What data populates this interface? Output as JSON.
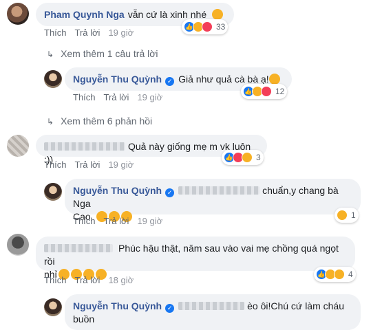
{
  "comments": [
    {
      "name": "Pham Quynh Nga",
      "text": "vẫn cứ là xinh nhé",
      "react_count": "33"
    },
    {
      "name": "Nguyễn Thu Quỳnh",
      "text": "Giả như quả cà bà ạ!",
      "react_count": "12"
    },
    {
      "text": "Quả này giống mẹ m vk luôn :))",
      "react_count": "3"
    },
    {
      "name": "Nguyễn Thu Quỳnh",
      "text_line1": "chuẩn,y chang bà Nga",
      "text_line2": "Cao",
      "react_count": "1"
    },
    {
      "text_line1": "Phúc hậu thật, năm sau vào vai mẹ chồng quá ngọt rồi",
      "text_line2": "nhỉ",
      "react_count": "4"
    },
    {
      "name": "Nguyễn Thu Quỳnh",
      "text_line1": "èo ôi!Chú cứ làm cháu",
      "text_line2": "buồn"
    }
  ],
  "actions": {
    "like": "Thích",
    "reply": "Trả lời"
  },
  "times": [
    "19 giờ",
    "19 giờ",
    "19 giờ",
    "19 giờ",
    "18 giờ"
  ],
  "more": {
    "first": "Xem thêm 1 câu trả lời",
    "second": "Xem thêm 6 phản hồi"
  },
  "icons": {
    "reply_arrow": "reply-arrow-icon",
    "verified": "verified-badge-icon"
  },
  "colors": {
    "name": "#385898",
    "bubble": "#f0f2f5",
    "like": "#1877f2",
    "haha": "#f7b125",
    "love": "#f33e58"
  }
}
